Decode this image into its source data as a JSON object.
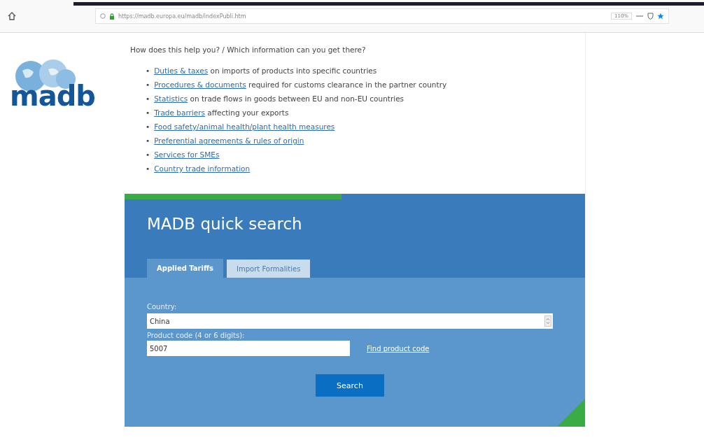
{
  "browser": {
    "url": "https://madb.europa.eu/madb/indexPubli.htm",
    "zoom": "110%"
  },
  "logo": {
    "text": "madb"
  },
  "intro": "How does this help you? / Which information can you get there?",
  "links": [
    {
      "bullet": "•",
      "link": "Duties & taxes",
      "rest": " on imports of products into specific countries"
    },
    {
      "bullet": "•",
      "link": "Procedures & documents",
      "rest": " required for customs clearance in the partner country"
    },
    {
      "bullet": "•",
      "link": "Statistics",
      "rest": " on trade flows in goods between EU and non-EU countries"
    },
    {
      "bullet": "•",
      "link": "Trade barriers",
      "rest": " affecting your exports"
    },
    {
      "bullet": "•",
      "link": "Food safety/animal health/plant health measures"
    },
    {
      "bullet": "•",
      "link": "Preferential agreements & rules of origin"
    },
    {
      "bullet": "•",
      "link": "Services for SMEs"
    },
    {
      "bullet": "•",
      "link": "Country trade information"
    }
  ],
  "quick_search": {
    "title": "MADB quick search",
    "tabs": [
      {
        "label": "Applied Tariffs",
        "selected": true
      },
      {
        "label": "Import Formalities",
        "selected": false
      }
    ],
    "country_label": "Country:",
    "country": "China",
    "product_label": "Product code (4 or 6 digits):",
    "product_code": "5007",
    "find_link": "Find product code",
    "button": "Search"
  }
}
